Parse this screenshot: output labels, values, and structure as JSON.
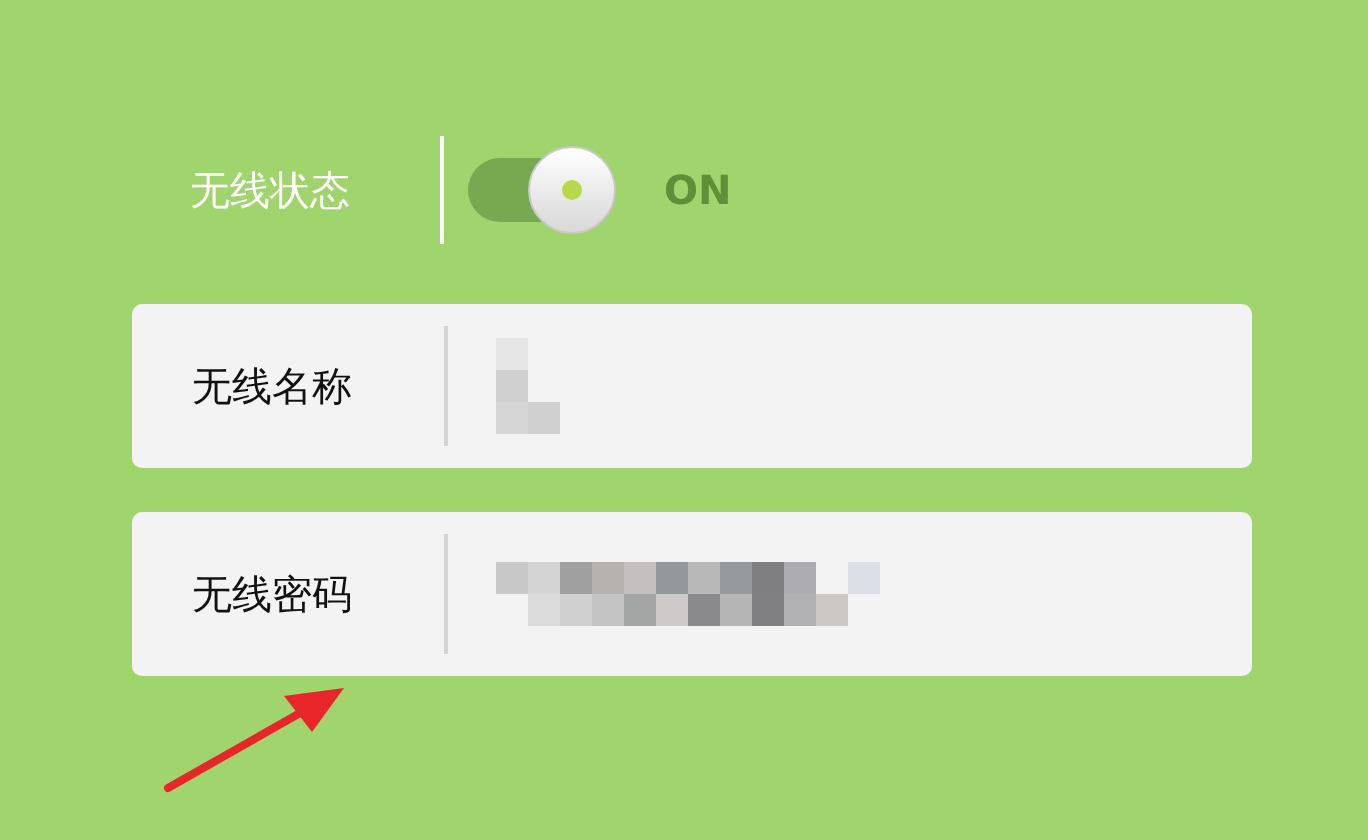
{
  "wireless_status": {
    "label": "无线状态",
    "on": true,
    "state_text": "ON"
  },
  "fields": [
    {
      "label": "无线名称",
      "kind": "name"
    },
    {
      "label": "无线密码",
      "kind": "password"
    }
  ]
}
